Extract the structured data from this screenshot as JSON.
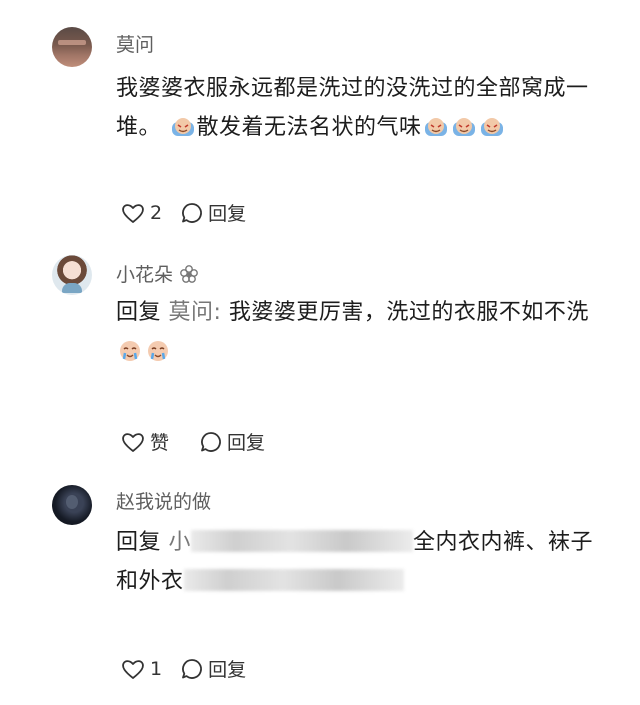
{
  "comments": [
    {
      "user": "莫问",
      "text_a": "我婆婆衣服永远都是洗过的没洗过的全部窝成一堆。",
      "text_b": "散发着无法名状的气味",
      "likes": "2",
      "reply_label": "回复"
    },
    {
      "user": "小花朵",
      "reply_prefix": "回复",
      "mention": "莫问:",
      "text_a": " 我婆婆更厉害，洗过的衣服不如不洗",
      "likes": "赞",
      "reply_label": "回复"
    },
    {
      "user": "赵我说的做",
      "reply_prefix": "回复",
      "line1_visible_start": "小",
      "line1_visible_end": "全内衣内裤、袜子",
      "line2_visible": "和外衣",
      "likes": "1",
      "reply_label": "回复"
    }
  ],
  "icons": {
    "emoji": "smiling-face-with-tears-emoji",
    "flower": "flower-icon",
    "like": "heart-icon",
    "reply": "speech-bubble-icon"
  }
}
